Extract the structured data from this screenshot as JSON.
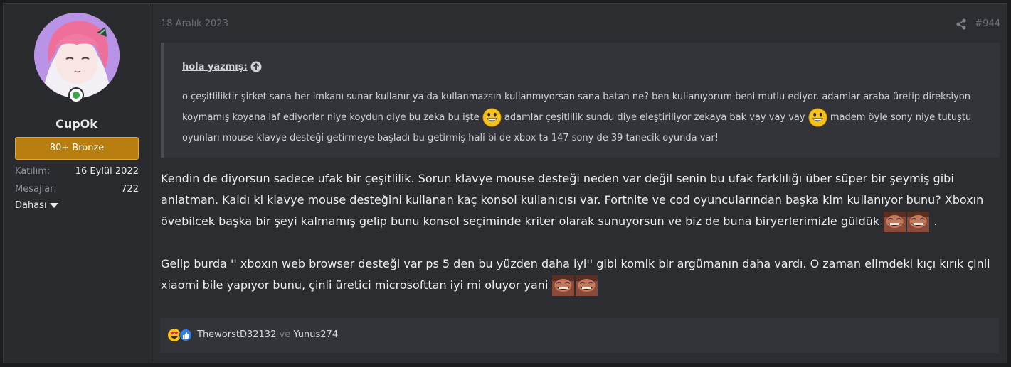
{
  "user": {
    "name": "CupOk",
    "badge": "80+ Bronze",
    "stats": [
      {
        "label": "Katılım:",
        "value": "16 Eylül 2022"
      },
      {
        "label": "Mesajlar:",
        "value": "722"
      }
    ],
    "more": "Dahası"
  },
  "post": {
    "date": "18 Aralık 2023",
    "number": "#944",
    "quote": {
      "author": "hola yazmış:",
      "text_1": "o çeşitliliktir şirket sana her imkanı sunar kullanır ya da kullanmazsın kullanmıyorsan sana batan ne? ben kullanıyorum beni mutlu ediyor. adamlar araba üretip direksiyon koymamış koyana laf ediyorlar niye koydun diye bu zeka bu işte",
      "text_2": "adamlar çeşitlilik sundu diye eleştiriliyor zekaya bak vay vay vay",
      "text_3": "madem öyle sony niye tutuştu oyunları mouse klavye desteği getirmeye başladı bu getirmiş hali bi de xbox ta 147 sony de 39 tanecik oyunda var!"
    },
    "paragraph_1": "Kendin de diyorsun sadece ufak bir çeşitlilik. Sorun klavye mouse desteği neden var değil senin bu ufak farklılığı über süper bir şeymiş gibi anlatman. Kaldı ki klavye mouse desteğini kullanan kaç konsol kullanıcısı var. Fortnite ve cod oyuncularından başka kim kullanıyor bunu? Xboxın övebilcek başka bir şeyi kalmamış gelip bunu konsol seçiminde kriter olarak sunuyorsun ve biz de buna biryerlerimizle güldük",
    "paragraph_1_end": ".",
    "paragraph_2": "Gelip burda '' xboxın web browser desteği var ps 5 den bu yüzden daha iyi'' gibi komik bir argümanın daha vardı. O zaman elimdeki kıçı kırık çinli xiaomi bile yapıyor bunu, çinli üretici microsofttan iyi mi oluyor yani"
  },
  "reactions": {
    "user_1": "TheworstD32132",
    "joiner": "ve",
    "user_2": "Yunus274"
  },
  "icons": [
    "online-status-icon",
    "share-icon",
    "quote-arrow-up-icon",
    "grin-smiley-icon",
    "laughing-meme-icon",
    "heart-eyes-reaction-icon",
    "like-reaction-icon",
    "caret-down-icon"
  ],
  "colors": {
    "badge": "#b77d0f",
    "accent_border": "#3d4f66",
    "online": "#3aa84a"
  }
}
